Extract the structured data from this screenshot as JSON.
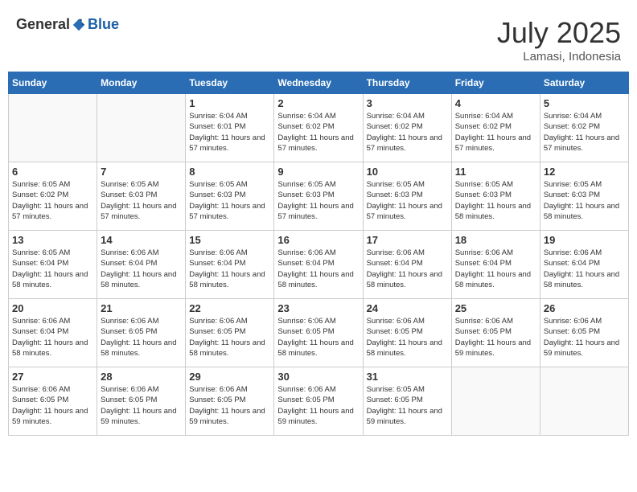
{
  "header": {
    "logo_general": "General",
    "logo_blue": "Blue",
    "month_year": "July 2025",
    "location": "Lamasi, Indonesia"
  },
  "weekdays": [
    "Sunday",
    "Monday",
    "Tuesday",
    "Wednesday",
    "Thursday",
    "Friday",
    "Saturday"
  ],
  "weeks": [
    [
      {
        "day": "",
        "sunrise": "",
        "sunset": "",
        "daylight": ""
      },
      {
        "day": "",
        "sunrise": "",
        "sunset": "",
        "daylight": ""
      },
      {
        "day": "1",
        "sunrise": "Sunrise: 6:04 AM",
        "sunset": "Sunset: 6:01 PM",
        "daylight": "Daylight: 11 hours and 57 minutes."
      },
      {
        "day": "2",
        "sunrise": "Sunrise: 6:04 AM",
        "sunset": "Sunset: 6:02 PM",
        "daylight": "Daylight: 11 hours and 57 minutes."
      },
      {
        "day": "3",
        "sunrise": "Sunrise: 6:04 AM",
        "sunset": "Sunset: 6:02 PM",
        "daylight": "Daylight: 11 hours and 57 minutes."
      },
      {
        "day": "4",
        "sunrise": "Sunrise: 6:04 AM",
        "sunset": "Sunset: 6:02 PM",
        "daylight": "Daylight: 11 hours and 57 minutes."
      },
      {
        "day": "5",
        "sunrise": "Sunrise: 6:04 AM",
        "sunset": "Sunset: 6:02 PM",
        "daylight": "Daylight: 11 hours and 57 minutes."
      }
    ],
    [
      {
        "day": "6",
        "sunrise": "Sunrise: 6:05 AM",
        "sunset": "Sunset: 6:02 PM",
        "daylight": "Daylight: 11 hours and 57 minutes."
      },
      {
        "day": "7",
        "sunrise": "Sunrise: 6:05 AM",
        "sunset": "Sunset: 6:03 PM",
        "daylight": "Daylight: 11 hours and 57 minutes."
      },
      {
        "day": "8",
        "sunrise": "Sunrise: 6:05 AM",
        "sunset": "Sunset: 6:03 PM",
        "daylight": "Daylight: 11 hours and 57 minutes."
      },
      {
        "day": "9",
        "sunrise": "Sunrise: 6:05 AM",
        "sunset": "Sunset: 6:03 PM",
        "daylight": "Daylight: 11 hours and 57 minutes."
      },
      {
        "day": "10",
        "sunrise": "Sunrise: 6:05 AM",
        "sunset": "Sunset: 6:03 PM",
        "daylight": "Daylight: 11 hours and 57 minutes."
      },
      {
        "day": "11",
        "sunrise": "Sunrise: 6:05 AM",
        "sunset": "Sunset: 6:03 PM",
        "daylight": "Daylight: 11 hours and 58 minutes."
      },
      {
        "day": "12",
        "sunrise": "Sunrise: 6:05 AM",
        "sunset": "Sunset: 6:03 PM",
        "daylight": "Daylight: 11 hours and 58 minutes."
      }
    ],
    [
      {
        "day": "13",
        "sunrise": "Sunrise: 6:05 AM",
        "sunset": "Sunset: 6:04 PM",
        "daylight": "Daylight: 11 hours and 58 minutes."
      },
      {
        "day": "14",
        "sunrise": "Sunrise: 6:06 AM",
        "sunset": "Sunset: 6:04 PM",
        "daylight": "Daylight: 11 hours and 58 minutes."
      },
      {
        "day": "15",
        "sunrise": "Sunrise: 6:06 AM",
        "sunset": "Sunset: 6:04 PM",
        "daylight": "Daylight: 11 hours and 58 minutes."
      },
      {
        "day": "16",
        "sunrise": "Sunrise: 6:06 AM",
        "sunset": "Sunset: 6:04 PM",
        "daylight": "Daylight: 11 hours and 58 minutes."
      },
      {
        "day": "17",
        "sunrise": "Sunrise: 6:06 AM",
        "sunset": "Sunset: 6:04 PM",
        "daylight": "Daylight: 11 hours and 58 minutes."
      },
      {
        "day": "18",
        "sunrise": "Sunrise: 6:06 AM",
        "sunset": "Sunset: 6:04 PM",
        "daylight": "Daylight: 11 hours and 58 minutes."
      },
      {
        "day": "19",
        "sunrise": "Sunrise: 6:06 AM",
        "sunset": "Sunset: 6:04 PM",
        "daylight": "Daylight: 11 hours and 58 minutes."
      }
    ],
    [
      {
        "day": "20",
        "sunrise": "Sunrise: 6:06 AM",
        "sunset": "Sunset: 6:04 PM",
        "daylight": "Daylight: 11 hours and 58 minutes."
      },
      {
        "day": "21",
        "sunrise": "Sunrise: 6:06 AM",
        "sunset": "Sunset: 6:05 PM",
        "daylight": "Daylight: 11 hours and 58 minutes."
      },
      {
        "day": "22",
        "sunrise": "Sunrise: 6:06 AM",
        "sunset": "Sunset: 6:05 PM",
        "daylight": "Daylight: 11 hours and 58 minutes."
      },
      {
        "day": "23",
        "sunrise": "Sunrise: 6:06 AM",
        "sunset": "Sunset: 6:05 PM",
        "daylight": "Daylight: 11 hours and 58 minutes."
      },
      {
        "day": "24",
        "sunrise": "Sunrise: 6:06 AM",
        "sunset": "Sunset: 6:05 PM",
        "daylight": "Daylight: 11 hours and 58 minutes."
      },
      {
        "day": "25",
        "sunrise": "Sunrise: 6:06 AM",
        "sunset": "Sunset: 6:05 PM",
        "daylight": "Daylight: 11 hours and 59 minutes."
      },
      {
        "day": "26",
        "sunrise": "Sunrise: 6:06 AM",
        "sunset": "Sunset: 6:05 PM",
        "daylight": "Daylight: 11 hours and 59 minutes."
      }
    ],
    [
      {
        "day": "27",
        "sunrise": "Sunrise: 6:06 AM",
        "sunset": "Sunset: 6:05 PM",
        "daylight": "Daylight: 11 hours and 59 minutes."
      },
      {
        "day": "28",
        "sunrise": "Sunrise: 6:06 AM",
        "sunset": "Sunset: 6:05 PM",
        "daylight": "Daylight: 11 hours and 59 minutes."
      },
      {
        "day": "29",
        "sunrise": "Sunrise: 6:06 AM",
        "sunset": "Sunset: 6:05 PM",
        "daylight": "Daylight: 11 hours and 59 minutes."
      },
      {
        "day": "30",
        "sunrise": "Sunrise: 6:06 AM",
        "sunset": "Sunset: 6:05 PM",
        "daylight": "Daylight: 11 hours and 59 minutes."
      },
      {
        "day": "31",
        "sunrise": "Sunrise: 6:05 AM",
        "sunset": "Sunset: 6:05 PM",
        "daylight": "Daylight: 11 hours and 59 minutes."
      },
      {
        "day": "",
        "sunrise": "",
        "sunset": "",
        "daylight": ""
      },
      {
        "day": "",
        "sunrise": "",
        "sunset": "",
        "daylight": ""
      }
    ]
  ]
}
